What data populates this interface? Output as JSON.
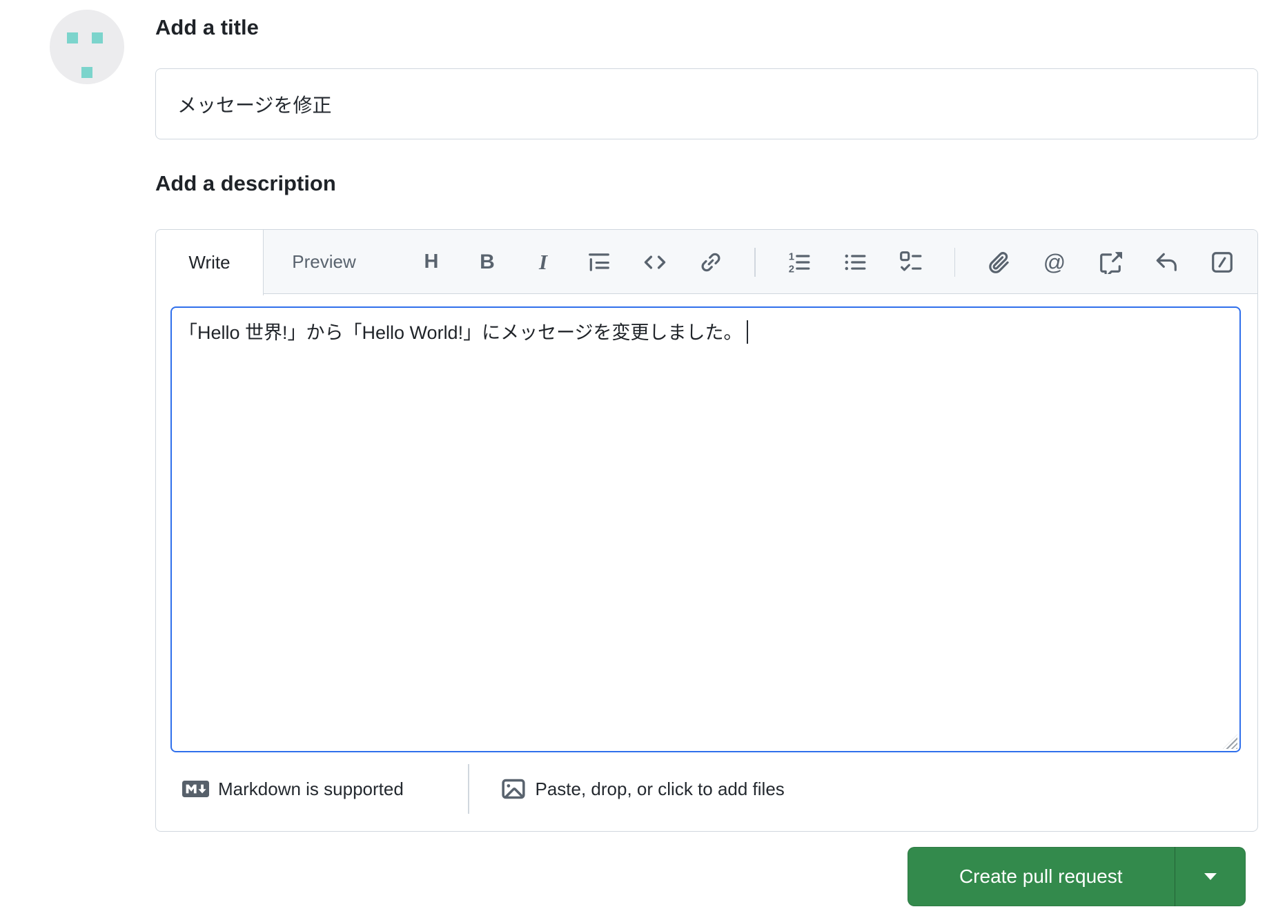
{
  "colors": {
    "accent_green": "#338a4c",
    "focus_blue": "#2f6feb",
    "border_gray": "#d0d7de",
    "muted_gray": "#59636e",
    "text_dark": "#1f2328",
    "toolbar_bg": "#f6f8fa",
    "identicon_teal": "#7cd4cc"
  },
  "avatar": {
    "kind": "identicon"
  },
  "title_section": {
    "heading": "Add a title",
    "input_value": "メッセージを修正"
  },
  "description_section": {
    "heading": "Add a description",
    "tabs": {
      "write": "Write",
      "preview": "Preview"
    },
    "toolbar_glyphs": {
      "heading": "H",
      "bold": "B",
      "italic": "I",
      "mention": "@"
    },
    "toolbar_icons": [
      "heading",
      "bold",
      "italic",
      "quote",
      "code",
      "link",
      "numbered-list",
      "bullet-list",
      "task-list",
      "attach-file",
      "mention",
      "cross-reference",
      "saved-replies",
      "slash-commands"
    ],
    "editor_text": "「Hello 世界!」から「Hello World!」にメッセージを変更しました。",
    "footer": {
      "markdown_note": "Markdown is supported",
      "paste_note": "Paste, drop, or click to add files"
    }
  },
  "actions": {
    "create_pull_request": "Create pull request"
  }
}
